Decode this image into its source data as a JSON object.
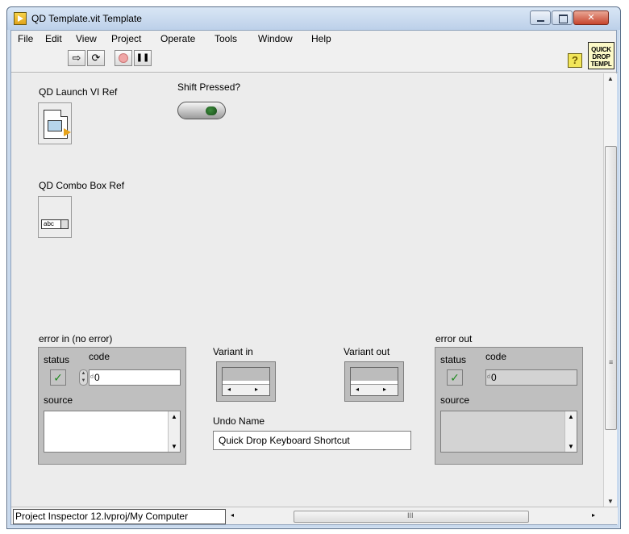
{
  "window": {
    "title": "QD Template.vit Template"
  },
  "menu": [
    "File",
    "Edit",
    "View",
    "Project",
    "Operate",
    "Tools",
    "Window",
    "Help"
  ],
  "toolbar": {
    "run_glyph": "⇨",
    "run_cont_glyph": "⟳",
    "pause_glyph": "❚❚",
    "help_glyph": "?",
    "badge_lines": [
      "QUICK",
      "DROP",
      "TEMPL"
    ]
  },
  "panel": {
    "launch_ref_label": "QD Launch VI Ref",
    "shift_pressed_label": "Shift Pressed?",
    "combo_ref_label": "QD Combo Box Ref",
    "combo_mini_text": "abc",
    "error_in": {
      "title": "error in (no error)",
      "status_label": "status",
      "code_label": "code",
      "source_label": "source",
      "status_glyph": "✓",
      "code_value": "0",
      "code_radix": "d"
    },
    "variant_in_label": "Variant in",
    "variant_out_label": "Variant out",
    "undo_name_label": "Undo Name",
    "undo_name_value": "Quick Drop Keyboard Shortcut",
    "error_out": {
      "title": "error out",
      "status_label": "status",
      "code_label": "code",
      "source_label": "source",
      "status_glyph": "✓",
      "code_value": "0",
      "code_radix": "d"
    }
  },
  "statusbar": {
    "context": "Project Inspector 12.lvproj/My Computer",
    "hscroll_grip": "III"
  },
  "colors": {
    "panel_bg": "#ececec",
    "cluster_bg": "#bfbfbf",
    "status_ok": "#1f8a1f",
    "led_off": "#174a17"
  }
}
